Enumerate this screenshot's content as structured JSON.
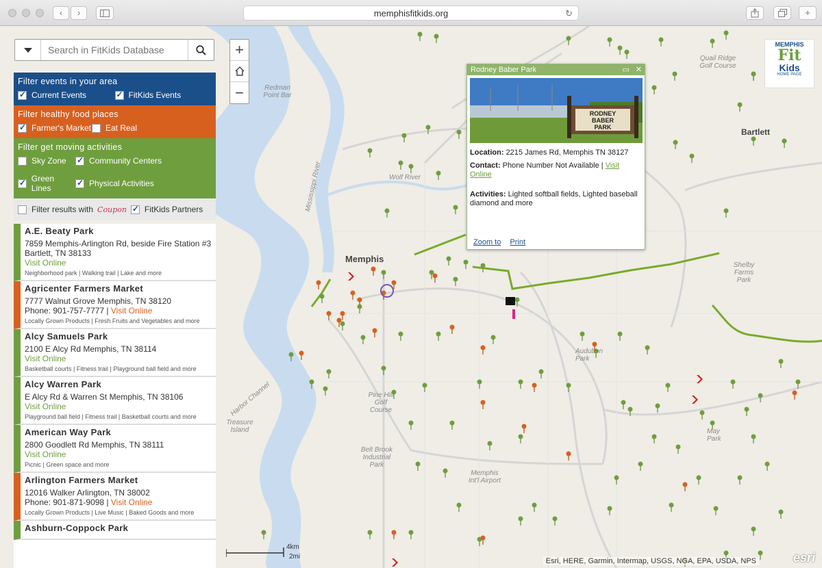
{
  "browser": {
    "url": "memphisfitkids.org",
    "back_icon": "‹",
    "forward_icon": "›"
  },
  "search": {
    "placeholder": "Search in FitKids Database"
  },
  "map_controls": {
    "zoom_in": "+",
    "home": "⌂",
    "zoom_out": "−"
  },
  "filters": {
    "events": {
      "heading": "Filter events in your area",
      "options": [
        {
          "label": "Current Events",
          "checked": true
        },
        {
          "label": "FitKids Events",
          "checked": true
        }
      ]
    },
    "food": {
      "heading": "Filter healthy food places",
      "options": [
        {
          "label": "Farmer's Market",
          "checked": true
        },
        {
          "label": "Eat Real",
          "checked": false
        }
      ]
    },
    "moving": {
      "heading": "Filter get moving activities",
      "options": [
        {
          "label": "Sky Zone",
          "checked": false
        },
        {
          "label": "Community Centers",
          "checked": true
        },
        {
          "label": "Green Lines",
          "checked": true
        },
        {
          "label": "Physical Activities",
          "checked": true
        }
      ]
    },
    "partners": {
      "label_prefix": "Filter results with",
      "coupon_text": "Coupon",
      "partners_label": "FitKids Partners",
      "prefix_checked": false,
      "partners_checked": true
    }
  },
  "results": [
    {
      "title": "A.E. Beaty Park",
      "type": "green",
      "address": "7859 Memphis-Arlington Rd, beside Fire Station #3 Bartlett, TN 38133",
      "phone": "",
      "link": "Visit Online",
      "tags": "Neighborhood park | Walking trail | Lake and more"
    },
    {
      "title": "Agricenter Farmers Market",
      "type": "orange",
      "address": "7777 Walnut Grove Memphis, TN 38120",
      "phone": "Phone: 901-757-7777 | ",
      "link": "Visit Online",
      "tags": "Locally Grown Products | Fresh Fruits and Vegetables and more"
    },
    {
      "title": "Alcy Samuels Park",
      "type": "green",
      "address": "2100 E Alcy Rd Memphis, TN 38114",
      "phone": "",
      "link": "Visit Online",
      "tags": "Basketball courts | Fitness trail | Playground ball field and more"
    },
    {
      "title": "Alcy Warren Park",
      "type": "green",
      "address": "E Alcy Rd & Warren St Memphis, TN 38106",
      "phone": "",
      "link": "Visit Online",
      "tags": "Playground ball field | Fitness trail | Basketball courts and more"
    },
    {
      "title": "American Way Park",
      "type": "green",
      "address": "2800 Goodlett Rd Memphis, TN 38111",
      "phone": "",
      "link": "Visit Online",
      "tags": "Picnic | Green space and more"
    },
    {
      "title": "Arlington Farmers Market",
      "type": "orange",
      "address": "12016 Walker Arlington, TN 38002",
      "phone": "Phone: 901-871-9098 | ",
      "link": "Visit Online",
      "tags": "Locally Grown Products | Live Music | Baked Goods and more"
    },
    {
      "title": "Ashburn-Coppock Park",
      "type": "green",
      "address": "",
      "phone": "",
      "link": "",
      "tags": ""
    }
  ],
  "popup": {
    "title": "Rodney Baber Park",
    "sign_text": [
      "RODNEY",
      "BABER",
      "PARK"
    ],
    "location_label": "Location:",
    "location": "2215 James Rd, Memphis TN 38127",
    "contact_label": "Contact:",
    "contact": "Phone Number Not Available | ",
    "contact_link": "Visit Online",
    "activities_label": "Activities:",
    "activities": "Lighted softball fields, Lighted baseball diamond and more",
    "zoom_to": "Zoom to",
    "print": "Print"
  },
  "logo": {
    "line1": "MEMPHIS",
    "line2": "Fit",
    "line3": "Kids",
    "line4": "HOME PAGE"
  },
  "map_labels": {
    "city": "Memphis",
    "bartlett": "Bartlett",
    "redman": "Redman Point Bar",
    "wolf_river": "Wolf River",
    "mississippi": "Mississippi River",
    "quail_ridge": "Quail Ridge Golf Course",
    "audubon": "Audubon Park",
    "pine_hill": "Pine Hill Golf Course",
    "treasure_island": "Treasure Island",
    "belt_brook": "Belt Brook Industrial Park",
    "airport": "Memphis Int'l Airport",
    "shelby_farms": "Shelby Farms Park",
    "may_park": "May Park",
    "harbor": "Harbor Channel",
    "scale_km": "4km",
    "scale_mi": "2mi"
  },
  "attribution": "Esri, HERE, Garmin, Intermap, USGS, NGA, EPA, USDA, NPS",
  "esri_logo": "esri",
  "colors": {
    "blue": "#1b4f8a",
    "orange": "#d8601f",
    "green": "#6f9e3e"
  }
}
